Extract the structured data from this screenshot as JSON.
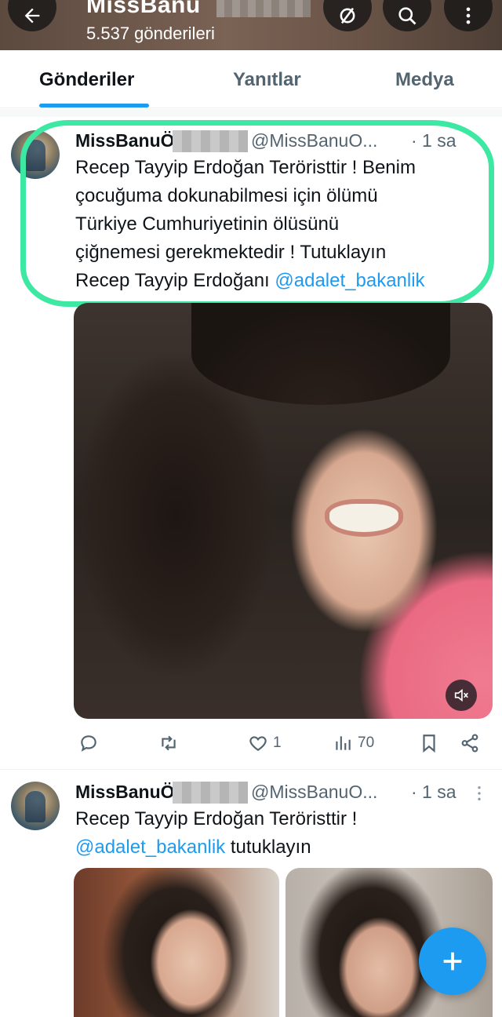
{
  "header": {
    "title": "MissBanu",
    "post_count": "5.537 gönderileri"
  },
  "tabs": [
    {
      "label": "Gönderiler",
      "active": true
    },
    {
      "label": "Yanıtlar",
      "active": false
    },
    {
      "label": "Medya",
      "active": false
    }
  ],
  "tweets": [
    {
      "name": "MissBanuÖ",
      "handle": "@MissBanuO...",
      "time": "· 1 sa",
      "text_lines": [
        "Recep Tayyip Erdoğan Teröristtir ! Benim",
        "çocuğuma dokunabilmesi için ölümü",
        "Türkiye Cumhuriyetinin ölüsünü",
        "çiğnemesi gerekmektedir ! Tutuklayın",
        "Recep Tayyip Erdoğanı"
      ],
      "mention": "@adalet_bakanlik",
      "stats": {
        "likes": "1",
        "views": "70"
      }
    },
    {
      "name": "MissBanuÖ",
      "handle": "@MissBanuO...",
      "time": "· 1 sa",
      "text_line1": "Recep Tayyip Erdoğan Teröristtir !",
      "mention": "@adalet_bakanlik",
      "text_after_mention": " tutuklayın"
    }
  ],
  "colors": {
    "accent": "#1d9bf0",
    "highlight": "#3ce8a2",
    "muted": "#536471"
  }
}
